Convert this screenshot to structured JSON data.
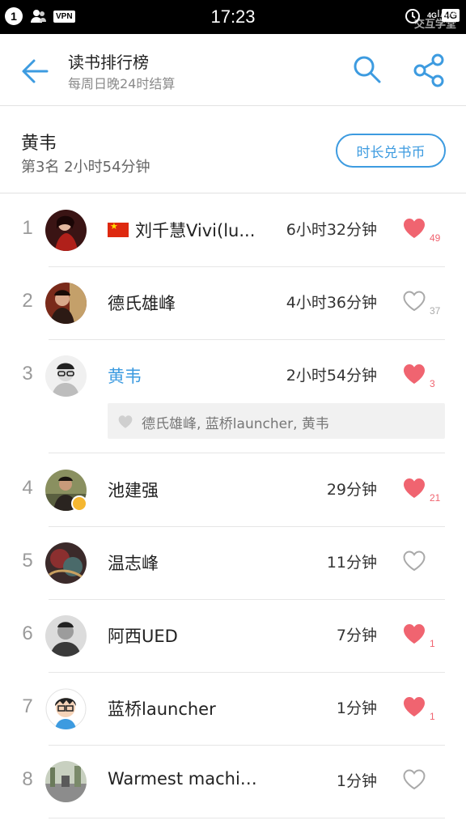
{
  "status_bar": {
    "notification_count": "1",
    "vpn": "VPN",
    "time": "17:23",
    "signal": "4G",
    "network": "4G",
    "watermark_top": "IAM",
    "watermark_bottom": "交互学堂"
  },
  "header": {
    "title": "读书排行榜",
    "subtitle": "每周日晚24时结算"
  },
  "mine": {
    "name": "黄韦",
    "rank_text": "第3名 2小时54分钟",
    "exchange_button": "时长兑书币"
  },
  "colors": {
    "accent": "#3d9be0",
    "like_on": "#f06470",
    "like_off": "#aaaaaa"
  },
  "ranking": [
    {
      "rank": "1",
      "name": "刘千慧Vivi(lu...",
      "time": "6小时32分钟",
      "liked": true,
      "likes": "49",
      "flag": true
    },
    {
      "rank": "2",
      "name": "德氏雄峰",
      "time": "4小时36分钟",
      "liked": false,
      "likes": "37"
    },
    {
      "rank": "3",
      "name": "黄韦",
      "time": "2小时54分钟",
      "liked": true,
      "likes": "3",
      "is_me": true
    },
    {
      "rank": "4",
      "name": "池建强",
      "time": "29分钟",
      "liked": true,
      "likes": "21",
      "verified": true
    },
    {
      "rank": "5",
      "name": "温志峰",
      "time": "11分钟",
      "liked": false,
      "likes": ""
    },
    {
      "rank": "6",
      "name": "阿西UED",
      "time": "7分钟",
      "liked": true,
      "likes": "1"
    },
    {
      "rank": "7",
      "name": "蓝桥launcher",
      "time": "1分钟",
      "liked": true,
      "likes": "1"
    },
    {
      "rank": "8",
      "name": "Warmest machine",
      "time": "1分钟",
      "liked": false,
      "likes": ""
    }
  ],
  "likers": {
    "text": "德氏雄峰, 蓝桥launcher, 黄韦"
  }
}
